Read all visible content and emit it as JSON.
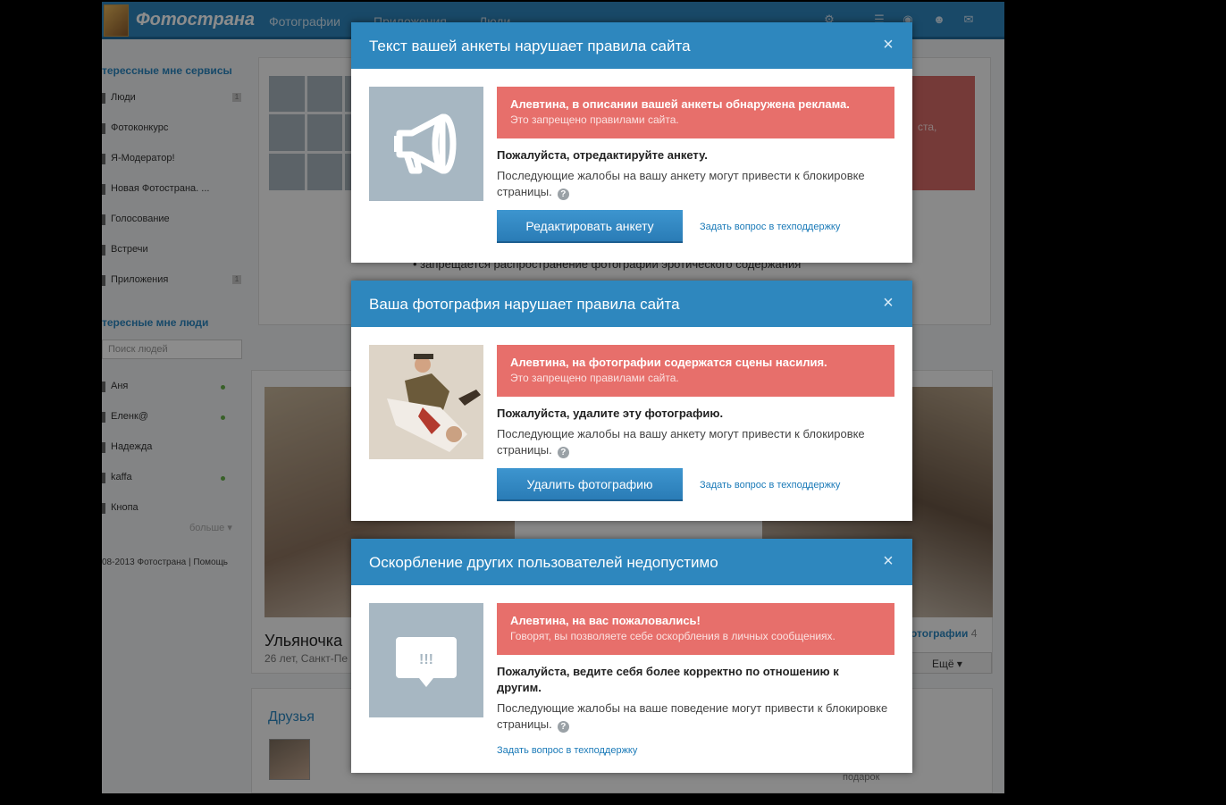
{
  "site": {
    "logo": "Фотострана",
    "nav": [
      "Фотографии",
      "Приложения",
      "Люди"
    ],
    "sidebar": {
      "services_title": "терессные мне сервисы",
      "services": [
        {
          "label": "Люди",
          "count": "1"
        },
        {
          "label": "Фотоконкурс",
          "count": ""
        },
        {
          "label": "Я-Модератор!",
          "count": ""
        },
        {
          "label": "Новая Фотострана. ...",
          "count": ""
        },
        {
          "label": "Голосование",
          "count": ""
        },
        {
          "label": "Встречи",
          "count": ""
        },
        {
          "label": "Приложения",
          "count": "1"
        }
      ],
      "people_title": "тересные мне люди",
      "search_placeholder": "Поиск людей",
      "people": [
        {
          "label": "Аня",
          "online": true
        },
        {
          "label": "Еленк@",
          "online": true
        },
        {
          "label": "Надежда",
          "online": false
        },
        {
          "label": "kaffa",
          "online": true
        },
        {
          "label": "Кнопа",
          "online": false
        }
      ],
      "more": "больше",
      "footer": "08-2013 Фотострана | Помощь"
    },
    "main": {
      "rule_text": "запрещается распространение фотографий эротического содержания",
      "banner_text": "ста,",
      "profile_name": "Ульяночка",
      "profile_sub": "26 лет, Санкт-Пе",
      "photos_link": "отографии",
      "photos_count": "4",
      "more_button": "Ещё",
      "friends_title": "Друзья",
      "gift_text": "подарок"
    }
  },
  "modals": [
    {
      "title": "Текст вашей анкеты нарушает правила сайта",
      "alert_title": "Алевтина, в описании вашей анкеты обнаружена реклама.",
      "alert_text": "Это запрещено правилами сайта.",
      "please": "Пожалуйста, отредактируйте анкету.",
      "warning": "Последующие жалобы на вашу анкету могут привести к блокировке страницы.",
      "button": "Редактировать анкету",
      "link": "Задать вопрос в техподдержку"
    },
    {
      "title": "Ваша фотография нарушает правила сайта",
      "alert_title": "Алевтина, на фотографии содержатся сцены насилия.",
      "alert_text": "Это запрещено правилами сайта.",
      "please": "Пожалуйста, удалите эту фотографию.",
      "warning": "Последующие жалобы на вашу анкету могут привести к блокировке страницы.",
      "button": "Удалить фотографию",
      "link": "Задать вопрос в техподдержку"
    },
    {
      "title": "Оскорбление других пользователей недопустимо",
      "alert_title": "Алевтина, на вас пожаловались!",
      "alert_text": "Говорят, вы позволяете себе оскорбления в личных сообщениях.",
      "please": "Пожалуйста, ведите себя более корректно по отношению к другим.",
      "warning": "Последующие жалобы на ваше поведение могут привести к блокировке страницы.",
      "link": "Задать вопрос в техподдержку",
      "icon_text": "!!!"
    }
  ],
  "icons": {
    "close": "close-icon",
    "help": "question-icon",
    "megaphone": "megaphone-icon",
    "speech": "speech-bubble-icon"
  },
  "colors": {
    "header_blue": "#2e87be",
    "alert_red": "#e76f6b",
    "button_blue": "#2a7cb6",
    "link_blue": "#1a7ab8"
  }
}
